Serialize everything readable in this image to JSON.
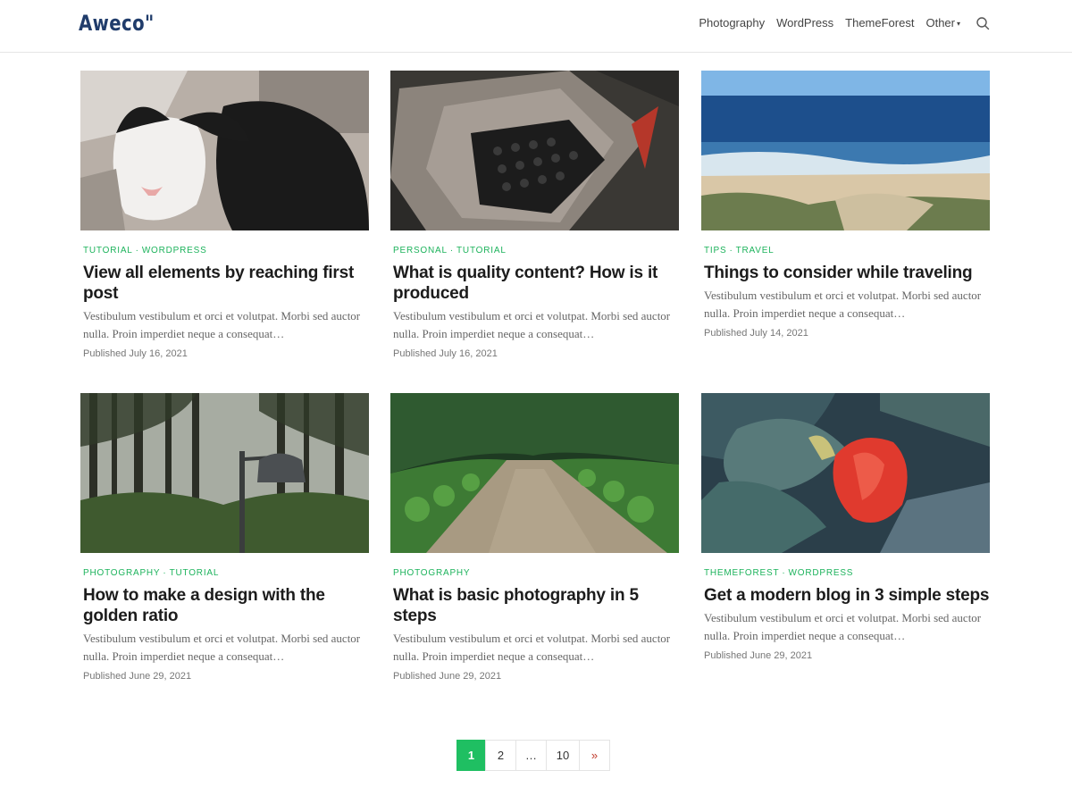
{
  "brand": {
    "logo": "Aweco\"",
    "color": "#203c6b"
  },
  "nav": {
    "items": [
      "Photography",
      "WordPress",
      "ThemeForest",
      "Other"
    ],
    "caret": "▾"
  },
  "accent": "#1db35c",
  "posts": [
    {
      "cat1": "TUTORIAL",
      "cat2": "WORDPRESS",
      "title": "View all elements by reaching first post",
      "excerpt": "Vestibulum vestibulum et orci et volutpat. Morbi sed auctor nulla. Proin imperdiet neque a consequat…",
      "date": "Published July 16, 2021"
    },
    {
      "cat1": "PERSONAL",
      "cat2": "TUTORIAL",
      "title": "What is quality content? How is it produced",
      "excerpt": "Vestibulum vestibulum et orci et volutpat. Morbi sed auctor nulla. Proin imperdiet neque a consequat…",
      "date": "Published July 16, 2021"
    },
    {
      "cat1": "TIPS",
      "cat2": "TRAVEL",
      "title": "Things to consider while traveling",
      "excerpt": "Vestibulum vestibulum et orci et volutpat. Morbi sed auctor nulla. Proin imperdiet neque a consequat…",
      "date": "Published July 14, 2021"
    },
    {
      "cat1": "PHOTOGRAPHY",
      "cat2": "TUTORIAL",
      "title": "How to make a design with the golden ratio",
      "excerpt": "Vestibulum vestibulum et orci et volutpat. Morbi sed auctor nulla. Proin imperdiet neque a consequat…",
      "date": "Published June 29, 2021"
    },
    {
      "cat1": "PHOTOGRAPHY",
      "cat2": "",
      "title": "What is basic photography in 5 steps",
      "excerpt": "Vestibulum vestibulum et orci et volutpat. Morbi sed auctor nulla. Proin imperdiet neque a consequat…",
      "date": "Published June 29, 2021"
    },
    {
      "cat1": "THEMEFOREST",
      "cat2": "WORDPRESS",
      "title": "Get a modern blog in 3 simple steps",
      "excerpt": "Vestibulum vestibulum et orci et volutpat. Morbi sed auctor nulla. Proin imperdiet neque a consequat…",
      "date": "Published June 29, 2021"
    }
  ],
  "category_separator": "·",
  "pagination": {
    "pages": [
      "1",
      "2",
      "…",
      "10"
    ],
    "next": "»",
    "active": "1",
    "active_color": "#1fbf62"
  }
}
